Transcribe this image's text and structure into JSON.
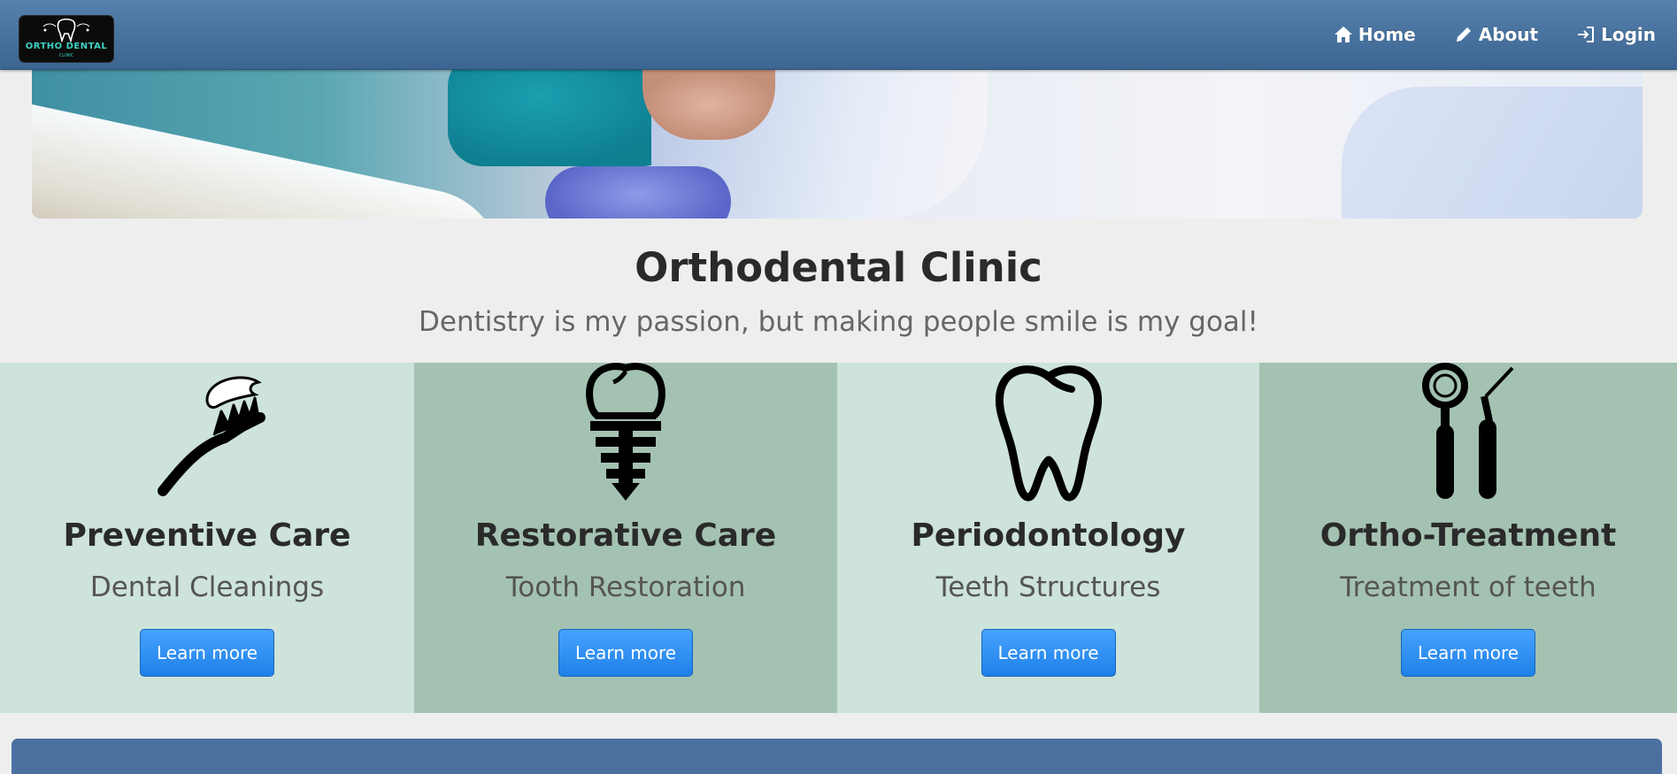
{
  "brand": {
    "logo_text": "ORTHO DENTAL",
    "logo_subtext": "CLINIC",
    "icon": "tooth-logo-icon"
  },
  "nav": {
    "items": [
      {
        "label": "Home",
        "icon": "home-icon"
      },
      {
        "label": "About",
        "icon": "pencil-icon"
      },
      {
        "label": "Login",
        "icon": "login-icon"
      }
    ]
  },
  "main": {
    "title": "Orthodental Clinic",
    "subtitle": "Dentistry is my passion, but making people smile is my goal!"
  },
  "services": [
    {
      "title": "Preventive Care",
      "subtitle": "Dental Cleanings",
      "button": "Learn more",
      "icon": "toothbrush-icon"
    },
    {
      "title": "Restorative Care",
      "subtitle": "Tooth Restoration",
      "button": "Learn more",
      "icon": "dental-implant-icon"
    },
    {
      "title": "Periodontology",
      "subtitle": "Teeth Structures",
      "button": "Learn more",
      "icon": "tooth-icon"
    },
    {
      "title": "Ortho-Treatment",
      "subtitle": "Treatment of teeth",
      "button": "Learn more",
      "icon": "dental-tools-icon"
    }
  ],
  "colors": {
    "navbar": "#4a72a0",
    "service_light": "#cde3db",
    "service_dark": "#a4c2b2",
    "button": "#2a8cf0",
    "footer_bar": "#4b70a0"
  }
}
